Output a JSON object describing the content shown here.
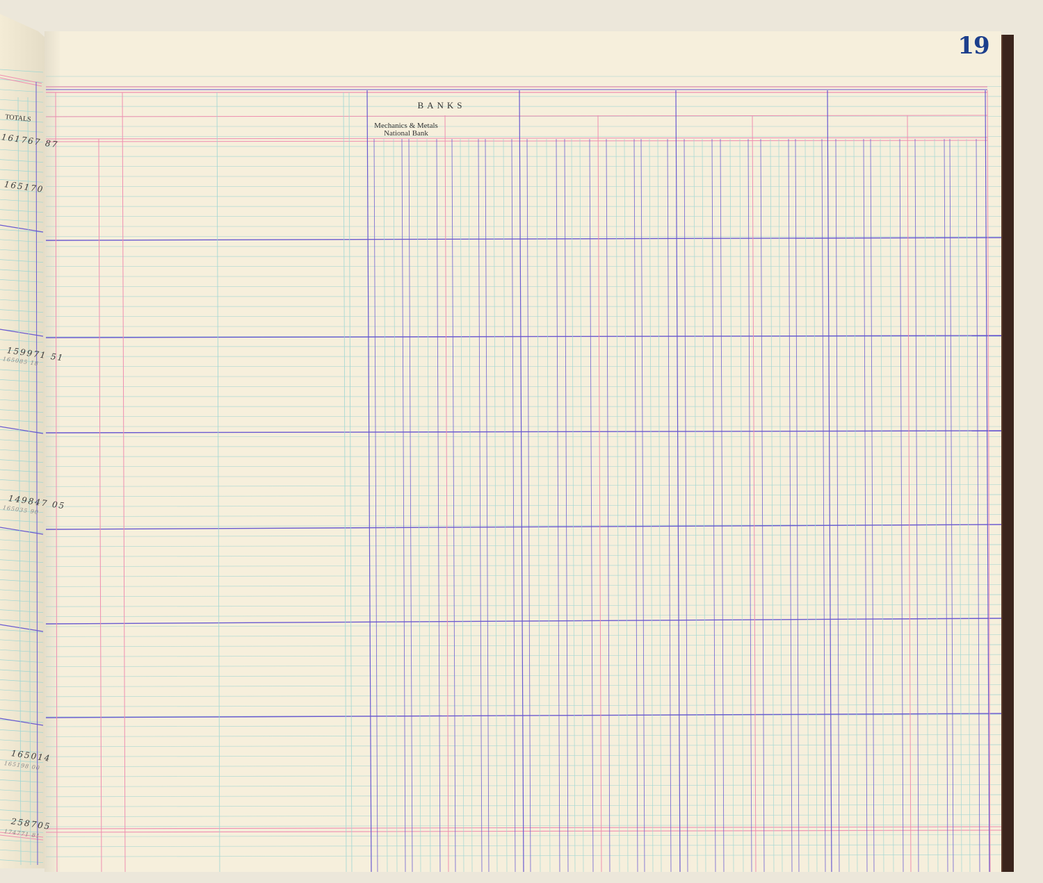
{
  "ledger": {
    "page_number": "19",
    "section_heading": "BANKS",
    "column_heading": "Mechanics & Metals National Bank",
    "left_page": {
      "totals_heading": "TOTALS",
      "entries": [
        {
          "main": "161767 87",
          "sub": ""
        },
        {
          "main": "165170",
          "sub": ""
        },
        {
          "main": "159971 51",
          "sub": "165085 18"
        },
        {
          "main": "149847 05",
          "sub": "165035 90"
        },
        {
          "main": "165014",
          "sub": "165198 00"
        },
        {
          "main": "258705",
          "sub": "174771 81"
        }
      ]
    }
  },
  "colors": {
    "paper": "#f6efdc",
    "red_rule": "#ef8fb0",
    "blue_rule": "#6a5ad0",
    "cyan_rule": "#9fd6d2",
    "page_number_ink": "#1d3f8c"
  }
}
